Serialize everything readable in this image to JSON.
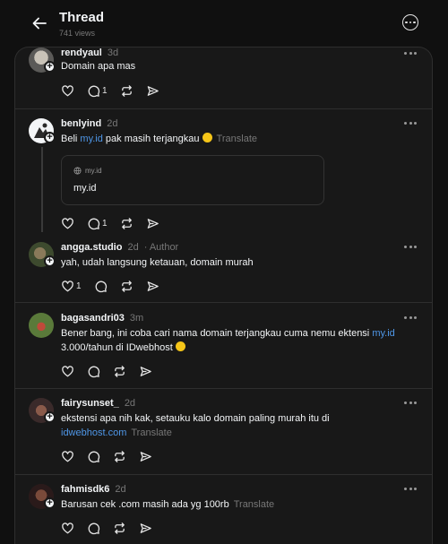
{
  "header": {
    "title": "Thread",
    "views": "741 views"
  },
  "posts": [
    {
      "username": "rendyaul",
      "time": "3d",
      "text": "Domain apa mas",
      "reply_count": "1"
    },
    {
      "username": "benlyind",
      "time": "2d",
      "text_before": "Beli ",
      "link": "my.id",
      "text_after": " pak masih terjangkau ",
      "translate": "Translate",
      "reply_count": "1",
      "card": {
        "host": "my.id",
        "title": "my.id"
      }
    },
    {
      "username": "angga.studio",
      "time": "2d",
      "author_tag": "· Author",
      "text": "yah, udah langsung ketauan, domain murah",
      "like_count": "1"
    },
    {
      "username": "bagasandri03",
      "time": "3m",
      "text_before": "Bener bang, ini coba cari nama domain terjangkau cuma nemu ektensi ",
      "link": "my.id",
      "text_after": "3.000/tahun di IDwebhost "
    },
    {
      "username": "fairysunset_",
      "time": "2d",
      "text_before": "ekstensi apa nih kak, setauku kalo domain paling murah itu di",
      "link": "idwebhost.com",
      "translate": "Translate"
    },
    {
      "username": "fahmisdk6",
      "time": "2d",
      "text": "Barusan cek .com masih ada yg 100rb",
      "translate": "Translate"
    }
  ],
  "colors": {
    "background": "#101010",
    "panel": "#181818",
    "link": "#4f97e8",
    "muted": "#777777"
  }
}
